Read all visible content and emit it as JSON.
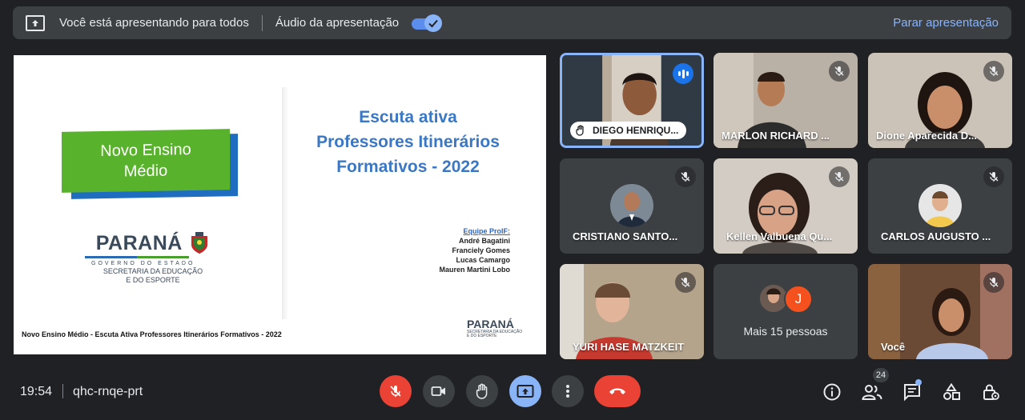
{
  "banner": {
    "presenting_text": "Você está apresentando para todos",
    "audio_label": "Áudio da apresentação",
    "audio_enabled": true,
    "stop_label": "Parar apresentação"
  },
  "slide": {
    "badge_text": "Novo Ensino Médio",
    "title_lines": [
      "Escuta ativa",
      "Professores Itinerários",
      "Formativos - 2022"
    ],
    "team_heading": "Equipe ProIF:",
    "team_members": [
      "André Bagatini",
      "Franciely Gomes",
      "Lucas Camargo",
      "Mauren Martini Lobo"
    ],
    "logo_text": "PARANÁ",
    "logo_gov": "GOVERNO DO ESTADO",
    "logo_sec1": "SECRETARIA DA EDUCAÇÃO",
    "logo_sec2": "E DO ESPORTE",
    "footer": "Novo Ensino Médio - Escuta Ativa Professores Itinerários Formativos - 2022",
    "mini_logo_text": "PARANÁ",
    "mini_sub1": "SECRETARIA DA EDUCAÇÃO",
    "mini_sub2": "E DO ESPORTE"
  },
  "participants": [
    {
      "name": "DIEGO HENRIQU...",
      "speaking": true,
      "muted": false
    },
    {
      "name": "MARLON RICHARD ...",
      "muted": true
    },
    {
      "name": "Dione Aparecida D...",
      "muted": true
    },
    {
      "name": "CRISTIANO SANTO...",
      "muted": true
    },
    {
      "name": "Kellen Valbuena Qu...",
      "muted": true
    },
    {
      "name": "CARLOS AUGUSTO ...",
      "muted": true
    },
    {
      "name": "YURI HASE MATZKEIT",
      "muted": true
    },
    {
      "name": "Você",
      "muted": true
    }
  ],
  "more": {
    "label": "Mais 15 pessoas",
    "initial": "J"
  },
  "bottom": {
    "time": "19:54",
    "meeting_code": "qhc-rnqe-prt",
    "people_count": "24"
  },
  "colors": {
    "accent": "#8ab4f8",
    "danger": "#ea4335",
    "background": "#202124",
    "tile": "#3c4043"
  },
  "icons": [
    "present-icon",
    "check-icon",
    "mic-off-icon",
    "camera-icon",
    "hand-icon",
    "present-now-icon",
    "more-vert-icon",
    "hang-up-icon",
    "info-icon",
    "people-icon",
    "chat-icon",
    "activities-icon",
    "host-controls-icon"
  ]
}
